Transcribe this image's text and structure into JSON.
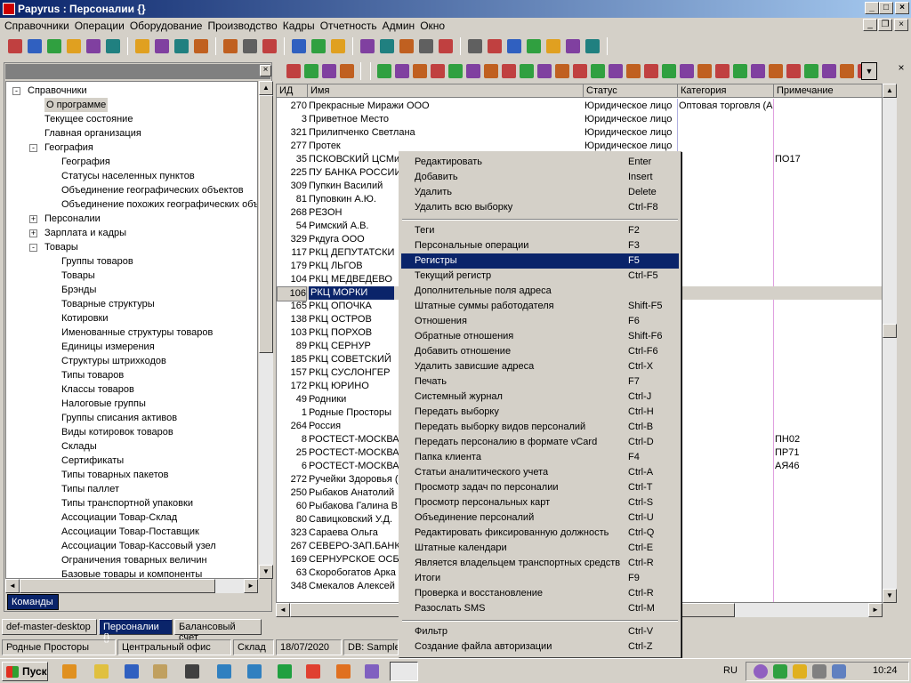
{
  "window": {
    "title": "Papyrus : Персоналии {}"
  },
  "menubar": [
    "Справочники",
    "Операции",
    "Оборудование",
    "Производство",
    "Кадры",
    "Отчетность",
    "Админ",
    "Окно"
  ],
  "tree": [
    {
      "label": "Справочники",
      "level": 0,
      "exp": "-"
    },
    {
      "label": "О программе",
      "level": 1,
      "selected": true
    },
    {
      "label": "Текущее состояние",
      "level": 1
    },
    {
      "label": "Главная организация",
      "level": 1
    },
    {
      "label": "География",
      "level": 1,
      "exp": "-"
    },
    {
      "label": "География",
      "level": 2
    },
    {
      "label": "Статусы населенных пунктов",
      "level": 2
    },
    {
      "label": "Объединение географических объектов",
      "level": 2
    },
    {
      "label": "Объединение похожих географических объ",
      "level": 2
    },
    {
      "label": "Персоналии",
      "level": 1,
      "exp": "+"
    },
    {
      "label": "Зарплата и кадры",
      "level": 1,
      "exp": "+"
    },
    {
      "label": "Товары",
      "level": 1,
      "exp": "-"
    },
    {
      "label": "Группы товаров",
      "level": 2
    },
    {
      "label": "Товары",
      "level": 2
    },
    {
      "label": "Брэнды",
      "level": 2
    },
    {
      "label": "Товарные структуры",
      "level": 2
    },
    {
      "label": "Котировки",
      "level": 2
    },
    {
      "label": "Именованные структуры товаров",
      "level": 2
    },
    {
      "label": "Единицы измерения",
      "level": 2
    },
    {
      "label": "Структуры штрихкодов",
      "level": 2
    },
    {
      "label": "Типы товаров",
      "level": 2
    },
    {
      "label": "Классы товаров",
      "level": 2
    },
    {
      "label": "Налоговые группы",
      "level": 2
    },
    {
      "label": "Группы списания активов",
      "level": 2
    },
    {
      "label": "Виды котировок товаров",
      "level": 2
    },
    {
      "label": "Склады",
      "level": 2
    },
    {
      "label": "Сертификаты",
      "level": 2
    },
    {
      "label": "Типы товарных пакетов",
      "level": 2
    },
    {
      "label": "Типы паллет",
      "level": 2
    },
    {
      "label": "Типы транспортной упаковки",
      "level": 2
    },
    {
      "label": "Ассоциации Товар-Склад",
      "level": 2
    },
    {
      "label": "Ассоциации Товар-Поставщик",
      "level": 2
    },
    {
      "label": "Ассоциации Товар-Кассовый узел",
      "level": 2
    },
    {
      "label": "Ограничения товарных величин",
      "level": 2
    },
    {
      "label": "Базовые товары и компоненты",
      "level": 2
    }
  ],
  "commands_tab": "Команды",
  "grid": {
    "headers": {
      "id": "ИД",
      "name": "Имя",
      "status": "Статус",
      "category": "Категория",
      "note": "Примечание"
    },
    "rows": [
      {
        "id": "270",
        "name": "Прекрасные Миражи ООО",
        "status": "Юридическое лицо",
        "category": "Оптовая торговля (А",
        "note": ""
      },
      {
        "id": "3",
        "name": "Приветное Место",
        "status": "Юридическое лицо",
        "category": "",
        "note": ""
      },
      {
        "id": "321",
        "name": "Прилипченко Светлана",
        "status": "Юридическое лицо",
        "category": "",
        "note": ""
      },
      {
        "id": "277",
        "name": "Протек",
        "status": "Юридическое лицо",
        "category": "",
        "note": ""
      },
      {
        "id": "35",
        "name": "ПСКОВСКИЙ ЦСМи",
        "status": "",
        "category": "",
        "note": "ПО17"
      },
      {
        "id": "225",
        "name": "ПУ БАНКА РОССИИ",
        "status": "",
        "category": "",
        "note": ""
      },
      {
        "id": "309",
        "name": "Пупкин Василий",
        "status": "",
        "category": "",
        "note": ""
      },
      {
        "id": "81",
        "name": "Пуповкин А.Ю.",
        "status": "",
        "category": "",
        "note": ""
      },
      {
        "id": "268",
        "name": "РЕЗОН",
        "status": "",
        "category": "",
        "note": ""
      },
      {
        "id": "54",
        "name": "Римский А.В.",
        "status": "",
        "category": "",
        "note": ""
      },
      {
        "id": "329",
        "name": "Ркдуга ООО",
        "status": "",
        "category": "",
        "note": ""
      },
      {
        "id": "117",
        "name": "РКЦ ДЕПУТАТСКИ",
        "status": "",
        "category": "",
        "note": ""
      },
      {
        "id": "179",
        "name": "РКЦ ЛЬГОВ",
        "status": "",
        "category": "",
        "note": ""
      },
      {
        "id": "104",
        "name": "РКЦ МЕДВЕДЕВО",
        "status": "",
        "category": "",
        "note": ""
      },
      {
        "id": "106",
        "name": "РКЦ МОРКИ",
        "status": "",
        "category": "",
        "note": "",
        "selected": true
      },
      {
        "id": "165",
        "name": "РКЦ ОПОЧКА",
        "status": "",
        "category": "",
        "note": ""
      },
      {
        "id": "138",
        "name": "РКЦ ОСТРОВ",
        "status": "",
        "category": "",
        "note": ""
      },
      {
        "id": "103",
        "name": "РКЦ ПОРХОВ",
        "status": "",
        "category": "",
        "note": ""
      },
      {
        "id": "89",
        "name": "РКЦ СЕРНУР",
        "status": "",
        "category": "",
        "note": ""
      },
      {
        "id": "185",
        "name": "РКЦ СОВЕТСКИЙ",
        "status": "",
        "category": "",
        "note": ""
      },
      {
        "id": "157",
        "name": "РКЦ СУСЛОНГЕР",
        "status": "",
        "category": "",
        "note": ""
      },
      {
        "id": "172",
        "name": "РКЦ ЮРИНО",
        "status": "",
        "category": "",
        "note": ""
      },
      {
        "id": "49",
        "name": "Родники",
        "status": "",
        "category": "",
        "note": ""
      },
      {
        "id": "1",
        "name": "Родные Просторы",
        "status": "",
        "category": "",
        "note": ""
      },
      {
        "id": "264",
        "name": "Россия",
        "status": "",
        "category": "",
        "note": ""
      },
      {
        "id": "8",
        "name": "РОСТЕСТ-МОСКВА",
        "status": "",
        "category": "",
        "note": "ПН02"
      },
      {
        "id": "25",
        "name": "РОСТЕСТ-МОСКВА",
        "status": "",
        "category": "",
        "note": "ПР71"
      },
      {
        "id": "6",
        "name": "РОСТЕСТ-МОСКВА",
        "status": "",
        "category": "",
        "note": "АЯ46"
      },
      {
        "id": "272",
        "name": "Ручейки Здоровья (",
        "status": "",
        "category": "",
        "note": ""
      },
      {
        "id": "250",
        "name": "Рыбаков Анатолий",
        "status": "",
        "category": "",
        "note": ""
      },
      {
        "id": "60",
        "name": "Рыбакова Галина В",
        "status": "",
        "category": "",
        "note": ""
      },
      {
        "id": "80",
        "name": "Савицковский У.Д.",
        "status": "",
        "category": "",
        "note": ""
      },
      {
        "id": "323",
        "name": "Сараева Ольга",
        "status": "",
        "category": "",
        "note": ""
      },
      {
        "id": "267",
        "name": "СЕВЕРО-ЗАП.БАНК",
        "status": "",
        "category": "",
        "note": ""
      },
      {
        "id": "169",
        "name": "СЕРНУРСКОЕ ОСБ",
        "status": "",
        "category": "",
        "note": ""
      },
      {
        "id": "63",
        "name": "Скоробогатов Арка",
        "status": "",
        "category": "",
        "note": ""
      },
      {
        "id": "348",
        "name": "Смекалов Алексей",
        "status": "",
        "category": "",
        "note": ""
      }
    ]
  },
  "context_menu": [
    {
      "label": "Редактировать",
      "shortcut": "Enter"
    },
    {
      "label": "Добавить",
      "shortcut": "Insert"
    },
    {
      "label": "Удалить",
      "shortcut": "Delete"
    },
    {
      "label": "Удалить всю выборку",
      "shortcut": "Ctrl-F8"
    },
    {
      "sep": true
    },
    {
      "label": "Теги",
      "shortcut": "F2"
    },
    {
      "label": "Персональные операции",
      "shortcut": "F3"
    },
    {
      "label": "Регистры",
      "shortcut": "F5",
      "selected": true
    },
    {
      "label": "Текущий регистр",
      "shortcut": "Ctrl-F5"
    },
    {
      "label": "Дополнительные поля адреса",
      "shortcut": ""
    },
    {
      "label": "Штатные суммы работодателя",
      "shortcut": "Shift-F5"
    },
    {
      "label": "Отношения",
      "shortcut": "F6"
    },
    {
      "label": "Обратные отношения",
      "shortcut": "Shift-F6"
    },
    {
      "label": "Добавить отношение",
      "shortcut": "Ctrl-F6"
    },
    {
      "label": "Удалить зависшие адреса",
      "shortcut": "Ctrl-X"
    },
    {
      "label": "Печать",
      "shortcut": "F7"
    },
    {
      "label": "Системный журнал",
      "shortcut": "Ctrl-J"
    },
    {
      "label": "Передать выборку",
      "shortcut": "Ctrl-H"
    },
    {
      "label": "Передать выборку видов персоналий",
      "shortcut": "Ctrl-B"
    },
    {
      "label": "Передать персоналию в формате vCard",
      "shortcut": "Ctrl-D"
    },
    {
      "label": "Папка клиента",
      "shortcut": "F4"
    },
    {
      "label": "Статьи аналитического учета",
      "shortcut": "Ctrl-A"
    },
    {
      "label": "Просмотр задач по персоналии",
      "shortcut": "Ctrl-T"
    },
    {
      "label": "Просмотр персональных карт",
      "shortcut": "Ctrl-S"
    },
    {
      "label": "Объединение персоналий",
      "shortcut": "Ctrl-U"
    },
    {
      "label": "Редактировать фиксированную должность",
      "shortcut": "Ctrl-Q"
    },
    {
      "label": "Штатные календари",
      "shortcut": "Ctrl-E"
    },
    {
      "label": "Является владельцем транспортных средств",
      "shortcut": "Ctrl-R"
    },
    {
      "label": "Итоги",
      "shortcut": "F9"
    },
    {
      "label": "Проверка и восстановление",
      "shortcut": "Ctrl-R"
    },
    {
      "label": "Разослать SMS",
      "shortcut": "Ctrl-M"
    },
    {
      "sep": true
    },
    {
      "label": "Фильтр",
      "shortcut": "Ctrl-V"
    },
    {
      "label": "Создание файла авторизации",
      "shortcut": "Ctrl-Z"
    }
  ],
  "window_tabs": [
    {
      "label": "def-master-desktop",
      "active": false
    },
    {
      "label": "Персоналии {}",
      "active": true
    },
    {
      "label": "Балансовый счет",
      "active": false
    }
  ],
  "status": {
    "org": "Родные Просторы",
    "office": "Центральный офис",
    "warehouse": "Склад",
    "date": "18/07/2020",
    "db": "DB: Sample"
  },
  "taskbar": {
    "start": "Пуск",
    "lang": "RU",
    "clock": "10:24"
  },
  "colors": {
    "selection": "#0a246a",
    "face": "#d4d0c8"
  }
}
